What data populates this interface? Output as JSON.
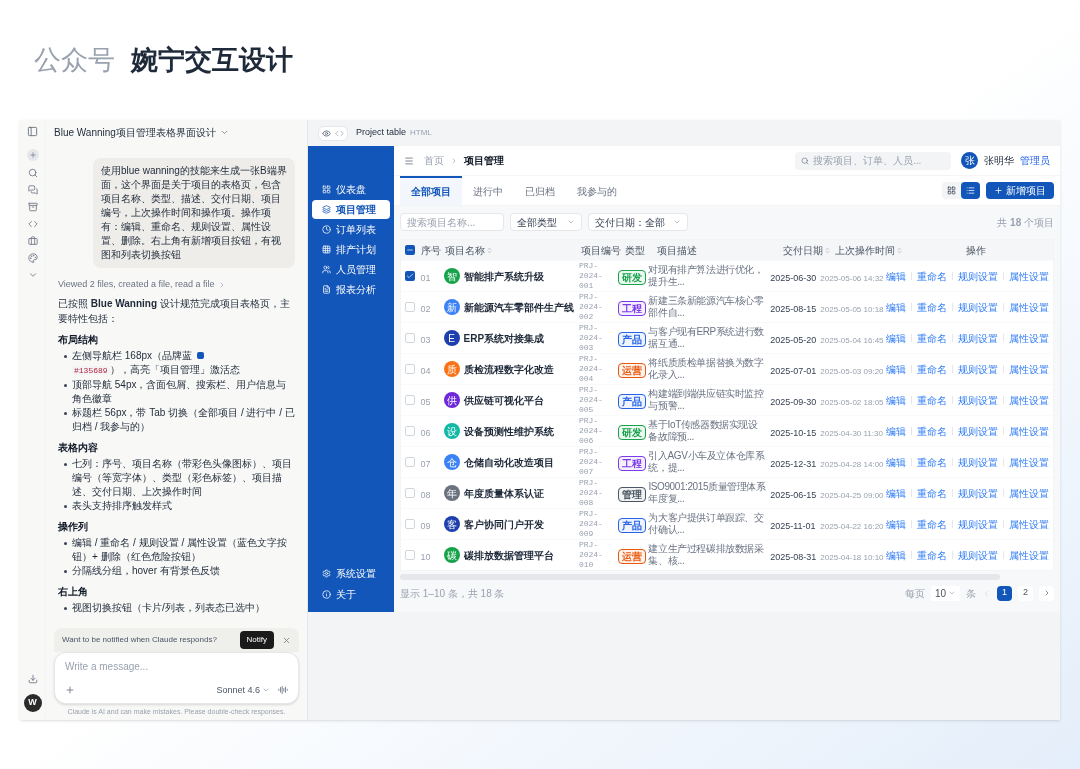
{
  "page_header": {
    "prefix": "公众号",
    "title": "婉宁交互设计"
  },
  "chat": {
    "title": "Blue Wanning项目管理表格界面设计",
    "user_message": "使用blue wanning的技能来生成一张B端界面，这个界面是关于项目的表格页，包含项目名称、类型、描述、交付日期、项目编号，上次操作时间和操作项。操作项有：编辑、重命名、规则设置、属性设置、删除。右上角有新增项目按钮，有视图和列表切换按钮",
    "activity": "Viewed 2 files, created a file, read a file",
    "intro": "已按照 **Blue Wanning** 设计规范完成项目表格页，主要特性包括：",
    "sections": [
      {
        "heading": "布局结构",
        "bullets": [
          {
            "text": "左侧导航栏 168px（品牌蓝 ",
            "color": "#1356b9",
            "code": "#135689",
            "after": "），高亮「项目管理」激活态"
          },
          {
            "text": "顶部导航 54px，含面包屑、搜索栏、用户信息与角色徽章"
          },
          {
            "text": "标题栏 56px，带 Tab 切换（全部项目 / 进行中 / 已归档 / 我参与的）"
          }
        ]
      },
      {
        "heading": "表格内容",
        "bullets": [
          {
            "text": "七列：序号、项目名称（带彩色头像图标）、项目编号（等宽字体）、类型（彩色标签）、项目描述、交付日期、上次操作时间"
          },
          {
            "text": "表头支持排序触发样式"
          }
        ]
      },
      {
        "heading": "操作列",
        "bullets": [
          {
            "text": "编辑 / 重命名 / 规则设置 / 属性设置（蓝色文字按钮）+ 删除（红色危险按钮）"
          },
          {
            "text": "分隔线分组，hover 有背景色反馈"
          }
        ]
      },
      {
        "heading": "右上角",
        "bullets": [
          {
            "text": "视图切换按钮（卡片/列表，列表态已选中）"
          }
        ]
      }
    ],
    "notify": {
      "text": "Want to be notified when Claude responds?",
      "button": "Notify"
    },
    "input": {
      "placeholder": "Write a message...",
      "model": "Sonnet 4.6"
    },
    "disclaimer": "Claude is AI and can make mistakes. Please double-check responses.",
    "user_avatar": "W"
  },
  "preview": {
    "title": "Project table",
    "type": "HTML"
  },
  "app": {
    "nav": [
      {
        "label": "仪表盘",
        "selected": false
      },
      {
        "label": "项目管理",
        "selected": true
      },
      {
        "label": "订单列表",
        "selected": false
      },
      {
        "label": "排产计划",
        "selected": false
      },
      {
        "label": "人员管理",
        "selected": false
      },
      {
        "label": "报表分析",
        "selected": false
      }
    ],
    "nav_bottom": [
      {
        "label": "系统设置"
      },
      {
        "label": "关于"
      }
    ],
    "breadcrumb": [
      "首页",
      "项目管理"
    ],
    "search": {
      "placeholder": "搜索项目、订单、人员..."
    },
    "user": {
      "avatar": "张",
      "name": "张明华",
      "role": "管理员"
    },
    "tabs": [
      {
        "label": "全部项目",
        "selected": true
      },
      {
        "label": "进行中",
        "selected": false
      },
      {
        "label": "已归档",
        "selected": false
      },
      {
        "label": "我参与的",
        "selected": false
      }
    ],
    "view_toggle": [
      {
        "kind": "grid",
        "selected": false
      },
      {
        "kind": "list",
        "selected": true
      }
    ],
    "add_button": "新增项目",
    "filters": {
      "search_placeholder": "搜索项目名称...",
      "type_select": "全部类型",
      "date_select": "交付日期：全部"
    },
    "count": "共 **18** 个项目",
    "table": {
      "header_checkbox": {
        "indeterminate": true
      },
      "columns": [
        {
          "label": "序号",
          "sortable": false
        },
        {
          "label": "项目名称",
          "sortable": true
        },
        {
          "label": "项目编号",
          "sortable": false
        },
        {
          "label": "类型",
          "sortable": false
        },
        {
          "label": "项目描述",
          "sortable": false
        },
        {
          "label": "交付日期",
          "sortable": true
        },
        {
          "label": "上次操作时间",
          "sortable": true
        },
        {
          "label": "操作",
          "sortable": false
        }
      ],
      "rows": [
        {
          "checked": true,
          "no": "01",
          "avatar": {
            "text": "智",
            "color": "#16a34a"
          },
          "name": "智能排产系统升级",
          "code": "PRJ-2024-001",
          "type": {
            "label": "研发",
            "color": "#16a34a"
          },
          "desc": "对现有排产算法进行优化，提升生...",
          "due": "2025-06-30",
          "last_op": "2025-05-06 14:32",
          "actions": [
            "编辑",
            "重命名",
            "规则设置",
            "属性设置"
          ]
        },
        {
          "checked": false,
          "no": "02",
          "avatar": {
            "text": "新",
            "color": "#3b82f6"
          },
          "name": "新能源汽车零部件生产线",
          "code": "PRJ-2024-002",
          "type": {
            "label": "工程",
            "color": "#7c3aed"
          },
          "desc": "新建三条新能源汽车核心零部件自...",
          "due": "2025-08-15",
          "last_op": "2025-05-05 10:18",
          "actions": [
            "编辑",
            "重命名",
            "规则设置",
            "属性设置"
          ]
        },
        {
          "checked": false,
          "no": "03",
          "avatar": {
            "text": "E",
            "color": "#1e40af"
          },
          "name": "ERP系统对接集成",
          "code": "PRJ-2024-003",
          "type": {
            "label": "产品",
            "color": "#2563eb"
          },
          "desc": "与客户现有ERP系统进行数据互通...",
          "due": "2025-05-20",
          "last_op": "2025-05-04 16:45",
          "actions": [
            "编辑",
            "重命名",
            "规则设置",
            "属性设置"
          ]
        },
        {
          "checked": false,
          "no": "04",
          "avatar": {
            "text": "质",
            "color": "#f97316"
          },
          "name": "质检流程数字化改造",
          "code": "PRJ-2024-004",
          "type": {
            "label": "运营",
            "color": "#ea580c"
          },
          "desc": "将纸质质检单据替换为数字化录入...",
          "due": "2025-07-01",
          "last_op": "2025-05-03 09:20",
          "actions": [
            "编辑",
            "重命名",
            "规则设置",
            "属性设置"
          ]
        },
        {
          "checked": false,
          "no": "05",
          "avatar": {
            "text": "供",
            "color": "#6d28d9"
          },
          "name": "供应链可视化平台",
          "code": "PRJ-2024-005",
          "type": {
            "label": "产品",
            "color": "#2563eb"
          },
          "desc": "构建端到端供应链实时监控与预警...",
          "due": "2025-09-30",
          "last_op": "2025-05-02 18:05",
          "actions": [
            "编辑",
            "重命名",
            "规则设置",
            "属性设置"
          ]
        },
        {
          "checked": false,
          "no": "06",
          "avatar": {
            "text": "设",
            "color": "#14b8a6"
          },
          "name": "设备预测性维护系统",
          "code": "PRJ-2024-006",
          "type": {
            "label": "研发",
            "color": "#16a34a"
          },
          "desc": "基于IoT传感器数据实现设备故障预...",
          "due": "2025-10-15",
          "last_op": "2025-04-30 11:30",
          "actions": [
            "编辑",
            "重命名",
            "规则设置",
            "属性设置"
          ]
        },
        {
          "checked": false,
          "no": "07",
          "avatar": {
            "text": "仓",
            "color": "#3b82f6"
          },
          "name": "仓储自动化改造项目",
          "code": "PRJ-2024-007",
          "type": {
            "label": "工程",
            "color": "#7c3aed"
          },
          "desc": "引入AGV小车及立体仓库系统，提...",
          "due": "2025-12-31",
          "last_op": "2025-04-28 14:00",
          "actions": [
            "编辑",
            "重命名",
            "规则设置",
            "属性设置"
          ]
        },
        {
          "checked": false,
          "no": "08",
          "avatar": {
            "text": "年",
            "color": "#6b7280"
          },
          "name": "年度质量体系认证",
          "code": "PRJ-2024-008",
          "type": {
            "label": "管理",
            "color": "#4b5563"
          },
          "desc": "ISO9001:2015质量管理体系年度复...",
          "due": "2025-06-15",
          "last_op": "2025-04-25 09:00",
          "actions": [
            "编辑",
            "重命名",
            "规则设置",
            "属性设置"
          ]
        },
        {
          "checked": false,
          "no": "09",
          "avatar": {
            "text": "客",
            "color": "#1e40af"
          },
          "name": "客户协同门户开发",
          "code": "PRJ-2024-009",
          "type": {
            "label": "产品",
            "color": "#2563eb"
          },
          "desc": "为大客户提供订单跟踪、交付确认...",
          "due": "2025-11-01",
          "last_op": "2025-04-22 16:20",
          "actions": [
            "编辑",
            "重命名",
            "规则设置",
            "属性设置"
          ]
        },
        {
          "checked": false,
          "no": "10",
          "avatar": {
            "text": "碳",
            "color": "#16a34a"
          },
          "name": "碳排放数据管理平台",
          "code": "PRJ-2024-010",
          "type": {
            "label": "运营",
            "color": "#ea580c"
          },
          "desc": "建立生产过程碳排放数据采集、核...",
          "due": "2025-08-31",
          "last_op": "2025-04-18 10:10",
          "actions": [
            "编辑",
            "重命名",
            "规则设置",
            "属性设置"
          ]
        }
      ]
    },
    "footer": {
      "summary": "显示 1–10 条，共 18 条",
      "per_page_label": "每页",
      "per_page": "10",
      "unit": "条",
      "pages": [
        {
          "label": "1",
          "selected": true
        },
        {
          "label": "2",
          "selected": false
        }
      ]
    }
  }
}
